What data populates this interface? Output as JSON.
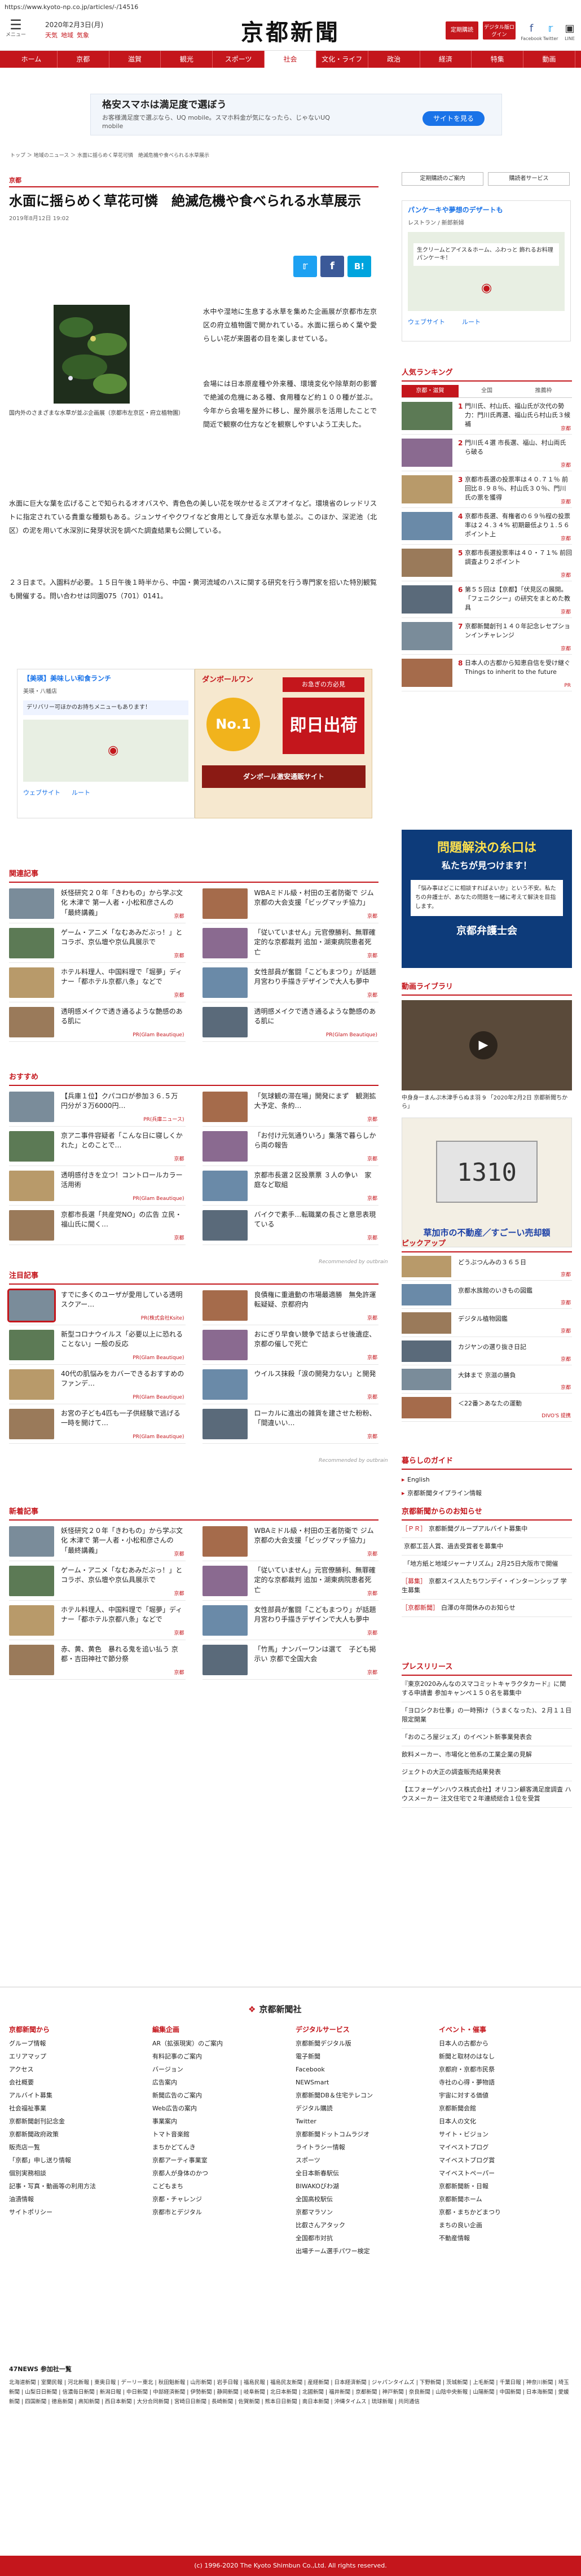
{
  "url": "https://www.kyoto-np.co.jp/articles/-/14516",
  "header": {
    "menu_label": "メニュー",
    "date": "2020年2月3日(月)",
    "weather": [
      "天気",
      "地域",
      "気象"
    ],
    "logo": "京都新聞",
    "btn_member": "定期購読",
    "btn_digital": "デジタル版ログイン",
    "soc_fb": "Facebook",
    "soc_tw": "Twitter",
    "soc_ln": "LINE"
  },
  "nav": [
    "ホーム",
    "京都",
    "滋賀",
    "観光",
    "スポーツ",
    "社会",
    "文化・ライフ",
    "政治",
    "経済",
    "特集",
    "動画"
  ],
  "top_ad": {
    "title": "格安スマホは満足度で選ぼう",
    "sub": "お客様満足度で選ぶなら、UQ mobile。スマホ料金が気になったら、じゃないUQ mobile",
    "cta": "サイトを見る"
  },
  "breadcrumb": "トップ ＞ 地域のニュース ＞ 水面に揺らめく草花可憐　絶滅危機や食べられる水草展示",
  "article": {
    "section": "京都",
    "title": "水面に揺らめく草花可憐　絶滅危機や食べられる水草展示",
    "date": "2019年8月12日 19:02",
    "caption": "国内外のさまざまな水草が並ぶ企画展（京都市左京区・府立植物園）",
    "p1": "水中や湿地に生息する水草を集めた企画展が京都市左京区の府立植物園で開かれている。水面に揺らめく葉や愛らしい花が来園者の目を楽しませている。",
    "p2": "会場には日本原産種や外来種、環境変化や除草剤の影響で絶滅の危機にある種、食用種など約１００種が並ぶ。今年から会場を屋外に移し、屋外展示を活用したことで間近で観察の仕方などを観察しやすいよう工夫した。",
    "p3": "水面に巨大な葉を広げることで知られるオオバスや、青色色の美しい花を咲かせるミズアオイなど。環境省のレッドリストに指定されている貴重な種類もある。ジュンサイやクワイなど食用として身近な水草も並ぶ。このほか、深泥池（北区）の泥を用いて水深別に発芽状況を調べた調査結果も公開している。",
    "p4": "２３日まで。入園料が必要。１５日午後１時半から、中国・黄河流域のハスに関する研究を行う専門家を招いた特別観覧も開催する。問い合わせは同園075（701）0141。"
  },
  "mid_ads": {
    "left_title": "【美瑛】美味しい和食ランチ",
    "left_sub": "美瑛・八幡店",
    "left_desc": "デリバリー可ほかのお持ちメニューもあります！",
    "left_map": "ウェブサイト",
    "left_route": "ルート",
    "right_brand": "ダンボールワン",
    "right_badge": "No.1",
    "right_title": "即日出荷",
    "right_sub": "お急ぎの方必見",
    "right_foot": "ダンボール激安通販サイト"
  },
  "side_top": {
    "btn1": "定期購読のご案内",
    "btn2": "購読者サービス"
  },
  "side_ad": {
    "title": "パンケーキや夢想のデザートも",
    "sub": "レストラン / 新郎新婦",
    "map_label": "生クリームとアイス＆ホーム、ふわっと 飾れるお料理パンケーキ！",
    "btn1": "ウェブサイト",
    "btn2": "ルート"
  },
  "ranking": {
    "title": "人気ランキング",
    "tabs": [
      "京都・滋賀",
      "全国",
      "推薦枠"
    ],
    "items": [
      {
        "n": "1",
        "tx": "門川氏、村山氏、福山氏が次代の勢力：門川氏再選、福山氏ら村山氏３候補",
        "src": "京都"
      },
      {
        "n": "2",
        "tx": "門川氏４選 市長選、福山、村山両氏ら破る",
        "src": "京都"
      },
      {
        "n": "3",
        "tx": "京都市長選の投票率は４０.７１％ 前回比８.９８％、村山氏３０％、門川氏の票を獲得",
        "src": "京都"
      },
      {
        "n": "4",
        "tx": "京都市長選、有権者の６９％程の投票率は２４.３４% 初期最低より１.５６ポイント上",
        "src": "京都"
      },
      {
        "n": "5",
        "tx": "京都市長選投票率は４０・７１% 前回調査より２ポイント",
        "src": "京都"
      },
      {
        "n": "6",
        "tx": "第５５回は【京都】「伏見区の展開。「フェニクシー」の研究をまとめた教具",
        "src": "京都"
      },
      {
        "n": "7",
        "tx": "京都新聞創刊１４０年記念レセプションインチャレンジ",
        "src": "京都"
      },
      {
        "n": "8",
        "tx": "日本人の古都から知恵自信を受け継ぐ Things to inherit to the future",
        "src": "PR"
      }
    ]
  },
  "side_ad2": {
    "title": "問題解決の糸口は",
    "sub": "私たちが見つけます！",
    "body": "「悩み事はどこに相談すればよいか」という不安。私たちの弁護士が、あなたの問題を一緒に考えて解決を目指します。",
    "foot": "京都弁護士会"
  },
  "video": {
    "title": "動画ライブラリ",
    "caption": "中身身一まんぷ木津手らぬま羽 9 「2020年2月2日 京都新聞ちから」",
    "ad_title": "草加市の不動産／すごーい売却額",
    "ad_num": "1310"
  },
  "pickup": {
    "title": "ピックアップ",
    "items": [
      {
        "tx": "どうぶつんみの３６５日",
        "src": "京都"
      },
      {
        "tx": "京都水族館のいきもの図鑑",
        "src": "京都"
      },
      {
        "tx": "デジタル植物図鑑",
        "src": "京都"
      },
      {
        "tx": "カジヤンの選り抜き日記",
        "src": "京都"
      },
      {
        "tx": "大鉢まで 京滋の勝負",
        "src": "京都"
      },
      {
        "tx": "＜22番＞あなたの運動",
        "src": "DIVO'S 提携"
      }
    ]
  },
  "kurashi": {
    "title": "暮らしのガイド",
    "items": [
      "English",
      "京都新聞タイプライン情報"
    ]
  },
  "news_notice": {
    "title": "京都新聞からのお知らせ",
    "items": [
      {
        "tag": "［ＰＲ］",
        "tx": "京都新聞グループアルバイト募集中"
      },
      {
        "tag": "",
        "tx": "京都工芸人賞、過去受賞者を募集中"
      },
      {
        "tag": "",
        "tx": "「地方紙と地域ジャーナリズム」2月25日大阪市で開催"
      },
      {
        "tag": "［募集］",
        "tx": "京都スイス人たちワンデイ・インターンシップ 学生募集"
      },
      {
        "tag": "［京都新聞］",
        "tx": "白澤の年間休みのお知らせ"
      }
    ]
  },
  "press": {
    "title": "プレスリリース",
    "items": [
      "『東京2020みんなのスマコミットキャラクタカード』に関する申請書 参加キャンペ１５０名を募集中",
      "「ヨロシクお仕事」の一時預け（うまくなった)、２月１１日限定開業",
      "「おのころ屋ジェズ」のイベント新事業発表会",
      "飲料メーカー、市場化と他系の工業企業の見解",
      "ジェクトの大正の調査販売結果発表",
      "【エフォーゲンハウス株式会社】オリコン顧客満足度調査 ハウスメーカー 注文住宅で２年連続総合１位を受賞"
    ]
  },
  "related": {
    "title": "関連記事",
    "items": [
      {
        "tx": "妖怪研究２０年「きわもの」から学ぶ文化 木津で 第一人者・小松和彦さんの「最終講義」",
        "src": "京都"
      },
      {
        "tx": "WBAミドル級・村田の王者防衛で ジム京都の大会支援「ビッグマッチ協力」",
        "src": "京都"
      },
      {
        "tx": "ゲーム・アニメ「なむあみだぶっ！」とコラボ、京仏壇や京仏具展示で",
        "src": "京都"
      },
      {
        "tx": "「従いていません」元官僚勝利、無罪確定的な京都裁判 追加・湖東病院患者死亡",
        "src": "京都"
      },
      {
        "tx": "ホテル料理人、中国料理で「堀夢」ディナー「都ホテル京都八条」などで",
        "src": "京都"
      },
      {
        "tx": "女性部員が奮闘「こどもまつり」が話題 月宮わり手描きデザインで大人も夢中",
        "src": "京都"
      },
      {
        "tx": "透明感メイクで透き通るような艶感のある肌に",
        "src": "PR(Glam Beautique)"
      },
      {
        "tx": "透明感メイクで透き通るような艶感のある肌に",
        "src": "PR(Glam Beautique)"
      }
    ]
  },
  "recommend": {
    "title": "おすすめ",
    "items": [
      {
        "tx": "【兵庫１位】クパコロが参加３６.５万円分が３万6000円…",
        "src": "PR(兵庫ニュース)"
      },
      {
        "tx": "「気球観の滞在場」開発にまず　観測拡大予定、条約…",
        "src": "京都"
      },
      {
        "tx": "京アニ事件容疑者「こんな日に寝しくかれた」とのことで…",
        "src": "京都"
      },
      {
        "tx": "「お付け元気通りいろ」集落で暮らしから両の報告",
        "src": "京都"
      },
      {
        "tx": "透明感付きを立つ！コントロールカラー活用術",
        "src": "PR(Glam Beautique)"
      },
      {
        "tx": "京都市長選２区投票票 ３人の争い　家庭など取組",
        "src": "京都"
      },
      {
        "tx": "京都市長選「共産党NO」の広告 立民・福山氏に聞く…",
        "src": "京都"
      },
      {
        "tx": "バイクで素手…転職業の長さと意思表現ている",
        "src": "京都"
      }
    ],
    "footer": "Recommended by outbrain"
  },
  "featured": {
    "title": "注目記事",
    "items": [
      {
        "tx": "すでに多くのユーザが愛用している透明スクアー…",
        "src": "PR(株式会社Ksite)"
      },
      {
        "tx": "良債権に重遺動の市場最適勝　無免許運転疑疑、京都府内",
        "src": "京都"
      },
      {
        "tx": "新型コロナウイルス「必要以上に恐れることない」一般の反応",
        "src": "PR(Glam Beautique)"
      },
      {
        "tx": "おにぎり早食い競争で詰まらせ後遺症、京都の催しで死亡",
        "src": "京都"
      },
      {
        "tx": "40代の肌悩みをカバーできるおすすめのファンデ…",
        "src": "PR(Glam Beautique)"
      },
      {
        "tx": "ウイルス抹殺「涙の開発力ない」と開発",
        "src": "京都"
      },
      {
        "tx": "お宮の子ども4匹も一子供経験で逃げる一時を開けて…",
        "src": "PR(Glam Beautique)"
      },
      {
        "tx": "ローカルに進出の雑貨を建させた粉粉、「間違いい…",
        "src": "京都"
      }
    ],
    "footer": "Recommended by outbrain"
  },
  "new_articles": {
    "title": "新着記事",
    "items": [
      {
        "tx": "妖怪研究２０年「きわもの」から学ぶ文化 木津で 第一人者・小松和彦さんの「最終講義」",
        "src": "京都"
      },
      {
        "tx": "WBAミドル級・村田の王者防衛で ジム京都の大会支援「ビッグマッチ協力」",
        "src": "京都"
      },
      {
        "tx": "ゲーム・アニメ「なむあみだぶっ！」とコラボ、京仏壇や京仏具展示で",
        "src": "京都"
      },
      {
        "tx": "「従いていません」元官僚勝利、無罪確定的な京都裁判 追加・湖東病院患者死亡",
        "src": "京都"
      },
      {
        "tx": "ホテル料理人、中国料理で「堀夢」ディナー「都ホテル京都八条」などで",
        "src": "京都"
      },
      {
        "tx": "女性部員が奮闘「こどもまつり」が話題 月宮わり手描きデザインで大人も夢中",
        "src": "京都"
      },
      {
        "tx": "赤、黄、黄色　暴れる鬼を追い払う 京都・吉田神社で節分祭",
        "src": "京都"
      },
      {
        "tx": "「竹馬」ナンバーワンは選て　子ども掲示い 京都で全国大会",
        "src": "京都"
      }
    ]
  },
  "footer": {
    "logo": "京都新聞社",
    "cols": [
      {
        "h": "京都新聞から",
        "items": [
          "グループ情報",
          "エリアマップ",
          "アクセス",
          "会社概要",
          "アルバイト募集",
          "社会福祉事業",
          "京都新聞創刊記念金",
          "京都新聞政府政策",
          "販売店一覧",
          "「京都」申し送り情報",
          "個別実務相談",
          "記事・写真・動画等の利用方法",
          "油漬情報",
          "サイトポリシー"
        ]
      },
      {
        "h": "編集企画",
        "items": [
          "AR（拡張現実）のご案内",
          "有料記事のご案内",
          "バージョン",
          "広告案内",
          "新聞広告のご案内",
          "Web広告の案内",
          "事業案内",
          "トマト音楽館",
          "まちかどてんき",
          "京都アーティ事業室",
          "京都人が身体のかつ",
          "こどもまち",
          "京都・チャレンジ",
          "京都市とデジタル"
        ]
      },
      {
        "h": "デジタルサービス",
        "items": [
          "京都新聞デジタル版",
          "電子新聞",
          "Facebook",
          "NEWSmart",
          "京都新聞DB＆住宅テレコン",
          "デジタル購読",
          "Twitter",
          "京都新聞ドットコムラジオ",
          "ライトラシー情報",
          "スポーツ",
          "全日本新春駅伝",
          "BIWAKOびわ湖",
          "全国高校駅伝",
          "京都マラソン",
          "比叡さんアタック",
          "全国都市対抗",
          "出場チーム選手パワー検定"
        ]
      },
      {
        "h": "イベント・催事",
        "items": [
          "日本人の古都から",
          "新聞と取材のはなし",
          "京都府・京都市民祭",
          "寺社の心得・夢物語",
          "宇宙に対する価値",
          "京都新聞会館",
          "日本人の文化",
          "サイト・ビジョン",
          "マイベストブログ",
          "マイベストブログ賞",
          "マイベストペーパー",
          "京都新聞新・日報",
          "京都新聞ホーム",
          "京都・まちかどまつり",
          "まちの良い企画",
          "不動産情報"
        ]
      }
    ]
  },
  "network": {
    "title": "47NEWS  参加社一覧",
    "text": "北海道新聞 | 室蘭民報 | 河北新報 | 東奥日報 | デーリー東北 | 秋田魁新報 | 山形新聞 | 岩手日報 | 福島民報 | 福島民友新聞 | 産経新聞 | 日本経済新聞 | ジャパンタイムズ | 下野新聞 | 茨城新聞 | 上毛新聞 | 千葉日報 | 神奈川新聞 | 埼玉新聞 | 山梨日日新聞 | 信濃毎日新聞 | 新潟日報 | 中日新聞 | 中部経済新聞 | 伊勢新聞 | 静岡新聞 | 岐阜新聞 | 北日本新聞 | 北國新聞 | 福井新聞 | 京都新聞 | 神戸新聞 | 奈良新聞 | 山陰中央新報 | 山陽新聞 | 中国新聞 | 日本海新聞 | 愛媛新聞 | 四国新聞 | 徳島新聞 | 高知新聞 | 西日本新聞 | 大分合同新聞 | 宮崎日日新聞 | 長崎新聞 | 佐賀新聞 | 熊本日日新聞 | 南日本新聞 | 沖縄タイムス | 琉球新報 | 共同通信"
  },
  "copyright": "(c) 1996-2020 The Kyoto Shimbun Co.,Ltd. All rights reserved.",
  "colors": {
    "brand": "#c4161c",
    "tw": "#1da1f2",
    "fb": "#3b5998",
    "hb": "#00a4de"
  }
}
